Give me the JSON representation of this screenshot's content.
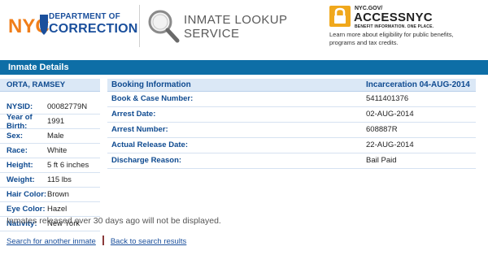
{
  "header": {
    "nyc_logo": "NYC",
    "department_line1": "DEPARTMENT OF",
    "department_line2": "CORRECTION",
    "lookup_line1": "INMATE LOOKUP",
    "lookup_line2": "SERVICE",
    "access_small": "NYC.GOV/",
    "access_big": "ACCESSNYC",
    "access_tagline": "BENEFIT INFORMATION. ONE PLACE.",
    "access_description": "Learn more about eligibility for public benefits, programs and tax credits."
  },
  "title": "Inmate Details",
  "inmate": {
    "name": "ORTA, RAMSEY",
    "fields": [
      {
        "label": "NYSID:",
        "value": "00082779N"
      },
      {
        "label": "Year of Birth:",
        "value": "1991"
      },
      {
        "label": "Sex:",
        "value": "Male"
      },
      {
        "label": "Race:",
        "value": "White"
      },
      {
        "label": "Height:",
        "value": "5 ft 6 inches"
      },
      {
        "label": "Weight:",
        "value": "115 lbs"
      },
      {
        "label": "Hair Color:",
        "value": "Brown"
      },
      {
        "label": "Eye Color:",
        "value": "Hazel"
      },
      {
        "label": "Nativity:",
        "value": "New York"
      }
    ]
  },
  "booking": {
    "header_left": "Booking Information",
    "header_right": "Incarceration 04-AUG-2014",
    "rows": [
      {
        "label": "Book & Case Number:",
        "value": "5411401376"
      },
      {
        "label": "Arrest Date:",
        "value": "02-AUG-2014"
      },
      {
        "label": "Arrest Number:",
        "value": "608887R"
      },
      {
        "label": "Actual Release Date:",
        "value": "22-AUG-2014"
      },
      {
        "label": "Discharge Reason:",
        "value": "Bail Paid"
      }
    ]
  },
  "notice": "Inmates released over 30 days ago will not be displayed.",
  "links": {
    "search_another": "Search for another inmate",
    "back_results": "Back to search results"
  },
  "colors": {
    "title_bar": "#0e6ea6",
    "brand_blue": "#1a4f9c",
    "nyc_orange": "#f07e1a",
    "access_orange": "#f0a81c"
  }
}
